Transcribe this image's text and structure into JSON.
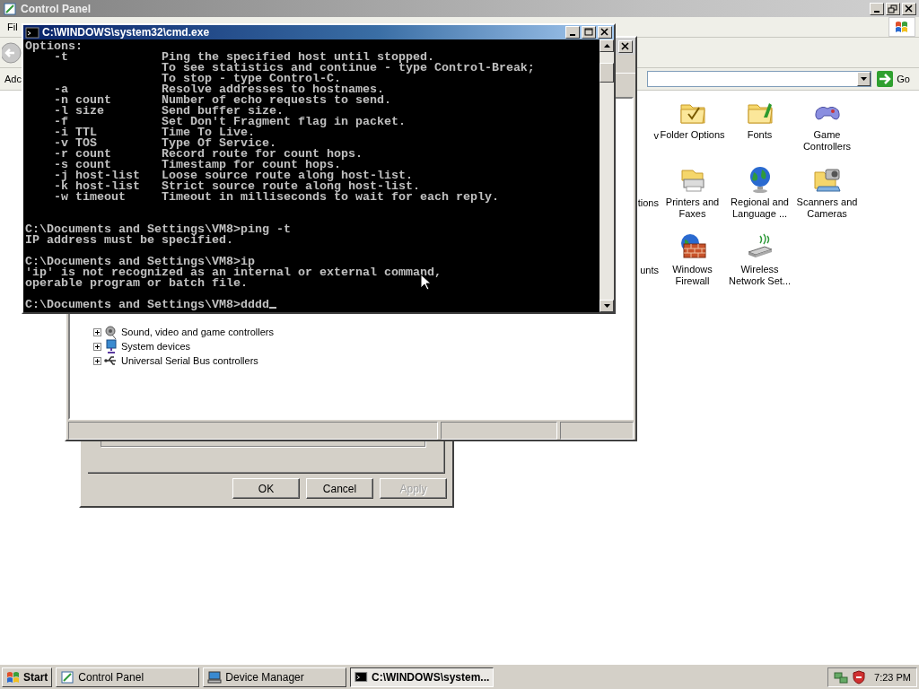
{
  "control_panel": {
    "title": "Control Panel",
    "menu_text": "Fil",
    "address_label": "Adc",
    "go_label": "Go",
    "cut_labels": [
      "v",
      "tions",
      "unts"
    ],
    "items": [
      {
        "label": "Folder Options"
      },
      {
        "label": "Fonts"
      },
      {
        "label": "Game Controllers"
      },
      {
        "label": "Printers and Faxes"
      },
      {
        "label": "Regional and Language ..."
      },
      {
        "label": "Scanners and Cameras"
      },
      {
        "label": "Windows Firewall"
      },
      {
        "label": "Wireless Network Set..."
      }
    ]
  },
  "device_manager": {
    "tree": [
      {
        "label": "Sound, video and game controllers",
        "expanded": false
      },
      {
        "label": "System devices",
        "expanded": false
      },
      {
        "label": "Universal Serial Bus controllers",
        "expanded": false
      }
    ]
  },
  "dialog": {
    "buttons": [
      {
        "label": "OK",
        "disabled": false
      },
      {
        "label": "Cancel",
        "disabled": false
      },
      {
        "label": "Apply",
        "disabled": true
      }
    ]
  },
  "console": {
    "title": "C:\\WINDOWS\\system32\\cmd.exe",
    "lines": [
      {
        "kind": "text",
        "text": "Options:"
      },
      {
        "kind": "text",
        "text": "    -t             Ping the specified host until stopped."
      },
      {
        "kind": "text",
        "text": "                   To see statistics and continue - type Control-Break;"
      },
      {
        "kind": "text",
        "text": "                   To stop - type Control-C."
      },
      {
        "kind": "text",
        "text": "    -a             Resolve addresses to hostnames."
      },
      {
        "kind": "text",
        "text": "    -n count       Number of echo requests to send."
      },
      {
        "kind": "text",
        "text": "    -l size        Send buffer size."
      },
      {
        "kind": "text",
        "text": "    -f             Set Don't Fragment flag in packet."
      },
      {
        "kind": "text",
        "text": "    -i TTL         Time To Live."
      },
      {
        "kind": "text",
        "text": "    -v TOS         Type Of Service."
      },
      {
        "kind": "text",
        "text": "    -r count       Record route for count hops."
      },
      {
        "kind": "text",
        "text": "    -s count       Timestamp for count hops."
      },
      {
        "kind": "text",
        "text": "    -j host-list   Loose source route along host-list."
      },
      {
        "kind": "text",
        "text": "    -k host-list   Strict source route along host-list."
      },
      {
        "kind": "text",
        "text": "    -w timeout     Timeout in milliseconds to wait for each reply."
      },
      {
        "kind": "blank"
      },
      {
        "kind": "blank"
      },
      {
        "kind": "text",
        "text": "C:\\Documents and Settings\\VM8>ping -t"
      },
      {
        "kind": "text",
        "text": "IP address must be specified."
      },
      {
        "kind": "blank"
      },
      {
        "kind": "text",
        "text": "C:\\Documents and Settings\\VM8>ip"
      },
      {
        "kind": "text",
        "text": "'ip' is not recognized as an internal or external command,"
      },
      {
        "kind": "text",
        "text": "operable program or batch file."
      },
      {
        "kind": "blank"
      },
      {
        "kind": "input",
        "text": "C:\\Documents and Settings\\VM8>dddd"
      }
    ]
  },
  "taskbar": {
    "start": "Start",
    "tasks": [
      {
        "label": "Control Panel",
        "selected": false
      },
      {
        "label": "Device Manager",
        "selected": false
      },
      {
        "label": "C:\\WINDOWS\\system...",
        "selected": true
      }
    ],
    "clock": "7:23 PM"
  }
}
